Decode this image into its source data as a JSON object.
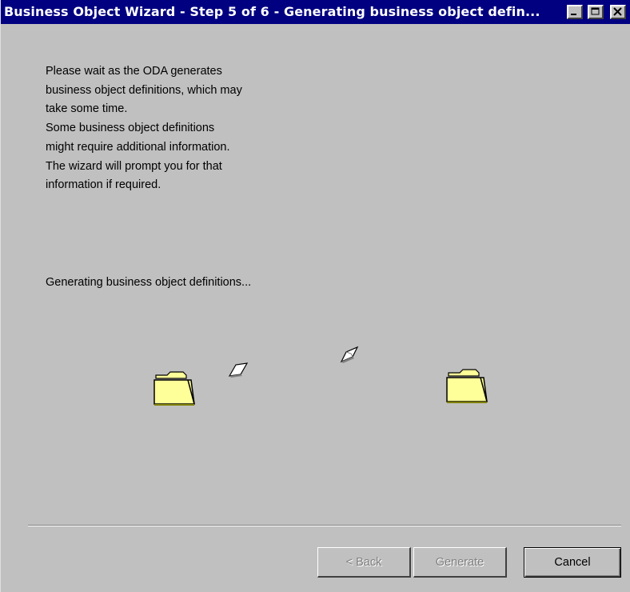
{
  "window": {
    "title": "Business Object Wizard - Step 5 of 6 - Generating business object defin..."
  },
  "intro_lines": [
    "Please wait as the ODA generates",
    "business object definitions, which may",
    "take some time.",
    "Some business object definitions",
    "might require additional information.",
    "The wizard will prompt you for that",
    "information if required."
  ],
  "status_text": "Generating business object definitions...",
  "buttons": {
    "back": "< Back",
    "generate": "Generate",
    "cancel": "Cancel"
  },
  "colors": {
    "titlebar": "#000080",
    "face": "#c0c0c0",
    "folder": "#ffff99"
  },
  "icons": [
    "folder-icon",
    "paper-icon",
    "folder-icon"
  ]
}
